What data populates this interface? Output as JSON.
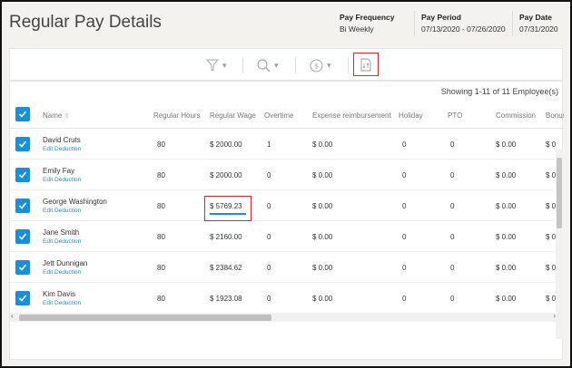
{
  "header": {
    "title": "Regular Pay Details",
    "pay_frequency": {
      "label": "Pay Frequency",
      "value": "Bi Weekly"
    },
    "pay_period": {
      "label": "Pay Period",
      "value": "07/13/2020 - 07/26/2020"
    },
    "pay_date": {
      "label": "Pay Date",
      "value": "07/31/2020"
    }
  },
  "toolbar": {
    "icons": [
      "filter-icon",
      "search-icon",
      "dollar-icon",
      "export-file-icon"
    ],
    "dropdown_glyph": "▾",
    "highlight_color": "#d9262c"
  },
  "table": {
    "showing": "Showing 1-11 of 11 Employee(s)",
    "sort_glyph": "⇕",
    "columns": [
      "Name",
      "Regular Hours",
      "Regular Wage",
      "Overtime",
      "Expense reimbursement",
      "Holiday",
      "PTO",
      "Commission",
      "Bonus"
    ],
    "edit_label": "Edit Deduction",
    "rows": [
      {
        "name": "David Cruts",
        "hours": "80",
        "wage": "$ 2000.00",
        "overtime": "1",
        "expense": "$ 0.00",
        "holiday": "0",
        "pto": "0",
        "commission": "$ 0.00",
        "bonus": "$ 0"
      },
      {
        "name": "Emily Fay",
        "hours": "80",
        "wage": "$ 2000.00",
        "overtime": "0",
        "expense": "$ 0.00",
        "holiday": "0",
        "pto": "0",
        "commission": "$ 0.00",
        "bonus": "$ 0"
      },
      {
        "name": "George Washington",
        "hours": "80",
        "wage": "$ 5769.23",
        "overtime": "0",
        "expense": "$ 0.00",
        "holiday": "0",
        "pto": "0",
        "commission": "$ 0.00",
        "bonus": "$ 0"
      },
      {
        "name": "Jane Smith",
        "hours": "80",
        "wage": "$ 2160.00",
        "overtime": "0",
        "expense": "$ 0.00",
        "holiday": "0",
        "pto": "0",
        "commission": "$ 0.00",
        "bonus": "$ 0"
      },
      {
        "name": "Jett Dunnigan",
        "hours": "80",
        "wage": "$ 2384.62",
        "overtime": "0",
        "expense": "$ 0.00",
        "holiday": "0",
        "pto": "0",
        "commission": "$ 0.00",
        "bonus": "$ 0"
      },
      {
        "name": "Kim Davis",
        "hours": "80",
        "wage": "$ 1923.08",
        "overtime": "0",
        "expense": "$ 0.00",
        "holiday": "0",
        "pto": "0",
        "commission": "$ 0.00",
        "bonus": "$ 0"
      }
    ],
    "accent_color": "#1a8fd9"
  }
}
